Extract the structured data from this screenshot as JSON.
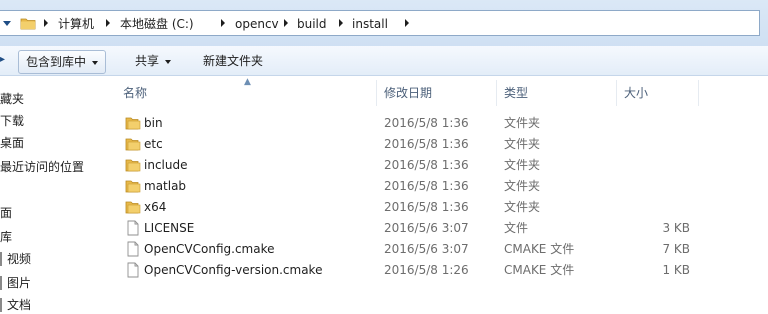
{
  "address": {
    "crumbs": [
      "计算机",
      "本地磁盘 (C:)",
      "opencv",
      "build",
      "install"
    ]
  },
  "toolbar": {
    "include_library": "包含到库中",
    "share": "共享",
    "new_folder": "新建文件夹"
  },
  "navpane": {
    "items": [
      "藏夹",
      "下载",
      "桌面",
      "最近访问的位置",
      "面",
      "库",
      "视频",
      "图片",
      "文档"
    ]
  },
  "columns": {
    "name": "名称",
    "modified": "修改日期",
    "type": "类型",
    "size": "大小"
  },
  "files": [
    {
      "name": "bin",
      "modified": "2016/5/8 1:36",
      "type": "文件夹",
      "size": "",
      "icon": "folder-icon"
    },
    {
      "name": "etc",
      "modified": "2016/5/8 1:36",
      "type": "文件夹",
      "size": "",
      "icon": "folder-icon"
    },
    {
      "name": "include",
      "modified": "2016/5/8 1:36",
      "type": "文件夹",
      "size": "",
      "icon": "folder-icon"
    },
    {
      "name": "matlab",
      "modified": "2016/5/8 1:36",
      "type": "文件夹",
      "size": "",
      "icon": "folder-icon"
    },
    {
      "name": "x64",
      "modified": "2016/5/8 1:36",
      "type": "文件夹",
      "size": "",
      "icon": "folder-icon"
    },
    {
      "name": "LICENSE",
      "modified": "2016/5/6 3:07",
      "type": "文件",
      "size": "3 KB",
      "icon": "file-icon"
    },
    {
      "name": "OpenCVConfig.cmake",
      "modified": "2016/5/6 3:07",
      "type": "CMAKE 文件",
      "size": "7 KB",
      "icon": "file-icon"
    },
    {
      "name": "OpenCVConfig-version.cmake",
      "modified": "2016/5/8 1:26",
      "type": "CMAKE 文件",
      "size": "1 KB",
      "icon": "file-icon"
    }
  ],
  "colors": {
    "folder": "#e8b94a",
    "accent": "#1f4d85",
    "header_text": "#4c607a",
    "dim_text": "#6d6d6d"
  }
}
